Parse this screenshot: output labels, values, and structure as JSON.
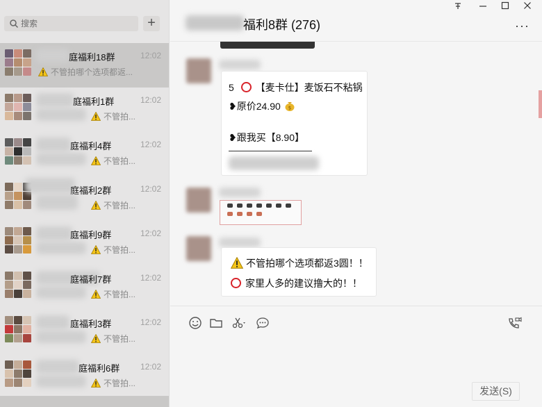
{
  "sidebar": {
    "search": {
      "placeholder": "搜索"
    },
    "add_label": "+",
    "chats": [
      {
        "name": "庭福利18群",
        "time": "12:02",
        "preview": "不管拍哪个选项都返...",
        "has_warning": true,
        "active": true
      },
      {
        "name": "庭福利1群",
        "time": "12:02",
        "preview": "不管拍...",
        "has_warning": true
      },
      {
        "name": "庭福利4群",
        "time": "12:02",
        "preview": "不管拍...",
        "has_warning": true
      },
      {
        "name": "庭福利2群",
        "time": "12:02",
        "preview": "不管拍...",
        "has_warning": true
      },
      {
        "name": "庭福利9群",
        "time": "12:02",
        "preview": "不管拍...",
        "has_warning": true
      },
      {
        "name": "庭福利7群",
        "time": "12:02",
        "preview": "不管拍...",
        "has_warning": true
      },
      {
        "name": "庭福利3群",
        "time": "12:02",
        "preview": "不管拍...",
        "has_warning": true
      },
      {
        "name": "庭福利6群",
        "time": "12:02",
        "preview": "不管拍...",
        "has_warning": true
      }
    ]
  },
  "window_controls": {
    "pin": "ⅹ",
    "minimize": "—",
    "maximize": "☐",
    "close": "✕"
  },
  "chat": {
    "title": "福利8群 (276)",
    "more": "···",
    "messages": [
      {
        "lines": [
          "5",
          "【麦卡仕】麦饭石不粘锅",
          "❥原价24.90",
          "❥跟我买【8.90】"
        ]
      },
      {
        "lines": [
          "不管拍哪个选项都返3圆！！",
          "家里人多的建议撸大的！！"
        ]
      }
    ],
    "send_label": "发送(S)"
  },
  "colors": {
    "sidebar_bg": "#e6e5e5",
    "active_item": "#c9c8c7",
    "main_bg": "#f5f5f5",
    "warning_yellow": "#f5c518",
    "red": "#d8232a"
  }
}
